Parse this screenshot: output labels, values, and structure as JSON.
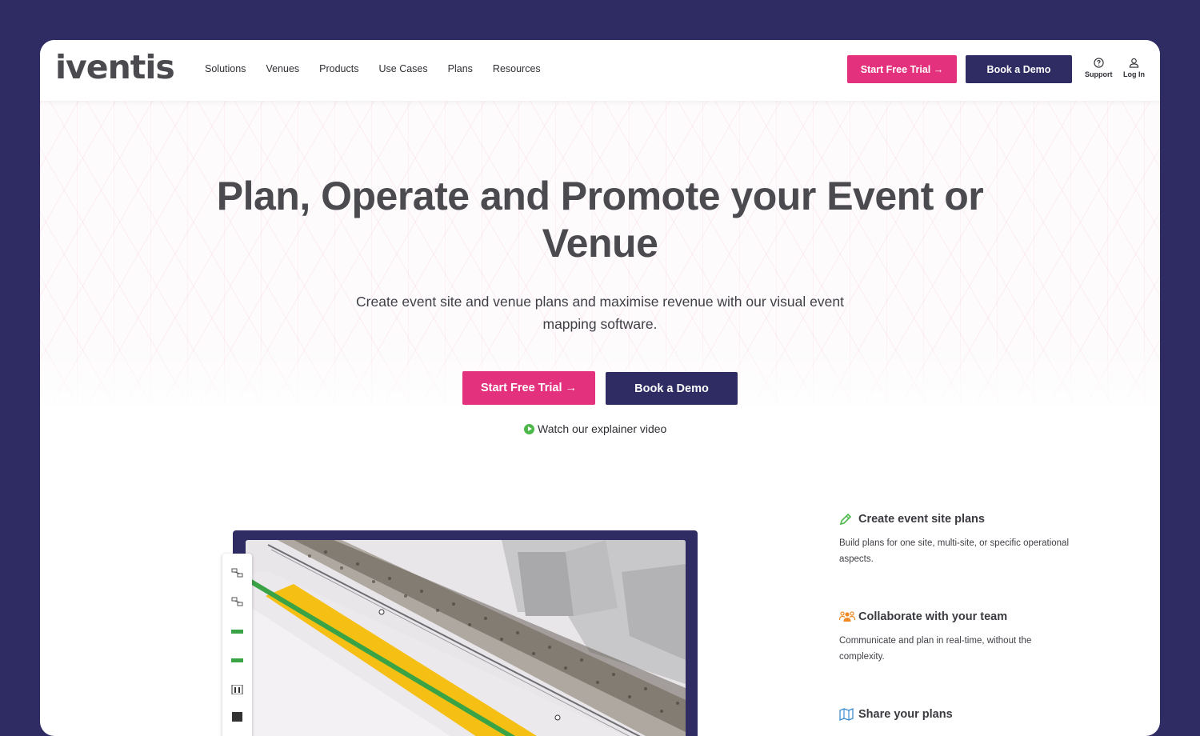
{
  "brand": {
    "logo_text": "iventis",
    "accent": "#e3317d",
    "navy": "#2e2c63"
  },
  "nav": {
    "items": [
      {
        "label": "Solutions"
      },
      {
        "label": "Venues"
      },
      {
        "label": "Products"
      },
      {
        "label": "Use Cases"
      },
      {
        "label": "Plans"
      },
      {
        "label": "Resources"
      }
    ],
    "trial_label": "Start Free Trial →",
    "demo_label": "Book a Demo",
    "support_label": "Support",
    "login_label": "Log In",
    "support_icon": "question-circle-icon",
    "login_icon": "user-icon"
  },
  "hero": {
    "title": "Plan, Operate and Promote your Event or Venue",
    "subtitle": "Create event site and venue plans and maximise revenue with our visual event mapping software.",
    "trial_label": "Start Free Trial →",
    "demo_label": "Book a Demo",
    "video_label": "Watch our explainer video",
    "video_icon": "play-circle-icon"
  },
  "features": [
    {
      "icon": "pencil-icon",
      "color": "#4cb849",
      "title": "Create event site plans",
      "desc": "Build plans for one site, multi-site, or specific operational aspects."
    },
    {
      "icon": "team-icon",
      "color": "#f08a24",
      "title": "Collaborate with your team",
      "desc": "Communicate and plan in real-time, without the complexity."
    },
    {
      "icon": "map-icon",
      "color": "#3e8ed0",
      "title": "Share your plans",
      "desc": ""
    }
  ]
}
